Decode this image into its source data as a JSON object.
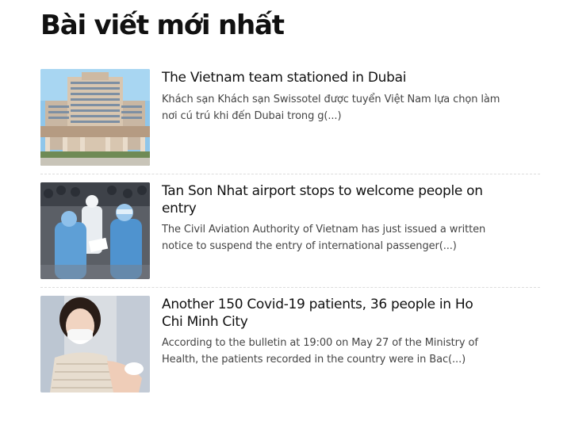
{
  "section": {
    "title": "Bài viết mới nhất"
  },
  "posts": [
    {
      "title": "The Vietnam team stationed in Dubai",
      "excerpt": "Khách sạn Khách sạn Swissotel được tuyển Việt Nam lựa chọn làm nơi cú trú khi đến Dubai trong g(...)",
      "thumbnail": "hotel-building-image"
    },
    {
      "title": "Tan Son Nhat airport stops to welcome people on entry",
      "excerpt": "The Civil Aviation Authority of Vietnam has just issued a written notice to suspend the entry of international passenger(...)",
      "thumbnail": "airport-medical-workers-image"
    },
    {
      "title": "Another 150 Covid-19 patients, 36 people in Ho Chi Minh City",
      "excerpt": "According to the bulletin at 19:00 on May 27 of the Ministry of Health, the patients recorded in the country were in Bac(...)",
      "thumbnail": "vaccination-woman-image"
    }
  ]
}
